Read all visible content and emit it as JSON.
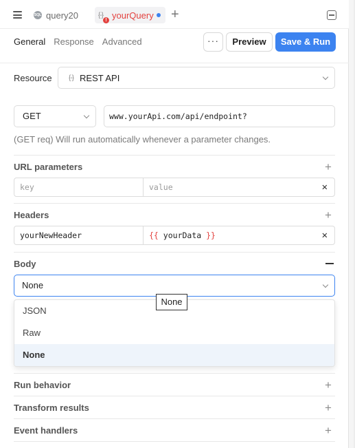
{
  "tabbar": {
    "tabs": [
      {
        "label": "query20",
        "icon": "sql-icon",
        "active": false
      },
      {
        "label": "yourQuery",
        "icon": "rest-api-icon",
        "active": true,
        "unsaved": true,
        "error": true
      }
    ],
    "error_color": "#e3423f",
    "unsaved_dot_color": "#3c83f0"
  },
  "toolbar": {
    "tabs": [
      "General",
      "Response",
      "Advanced"
    ],
    "active_tab": "General",
    "more_label": "···",
    "preview_label": "Preview",
    "save_run_label": "Save & Run",
    "accent": "#3c83f0"
  },
  "resource": {
    "label": "Resource",
    "icon_glyph": "{-}",
    "value": "REST API"
  },
  "request": {
    "method": "GET",
    "url": "www.yourApi.com/api/endpoint?",
    "hint": "(GET req) Will run automatically whenever a parameter changes."
  },
  "url_parameters": {
    "title": "URL parameters",
    "rows": [
      {
        "key_placeholder": "key",
        "value_placeholder": "value"
      }
    ]
  },
  "headers": {
    "title": "Headers",
    "rows": [
      {
        "key": "yourNewHeader",
        "value_open": "{{",
        "value_inner": "yourData",
        "value_close": "}}"
      }
    ]
  },
  "body": {
    "title": "Body",
    "selected": "None",
    "tooltip": "None",
    "options": [
      "JSON",
      "Raw",
      "None"
    ]
  },
  "sections": [
    {
      "title": "Run behavior"
    },
    {
      "title": "Transform results"
    },
    {
      "title": "Event handlers"
    }
  ]
}
